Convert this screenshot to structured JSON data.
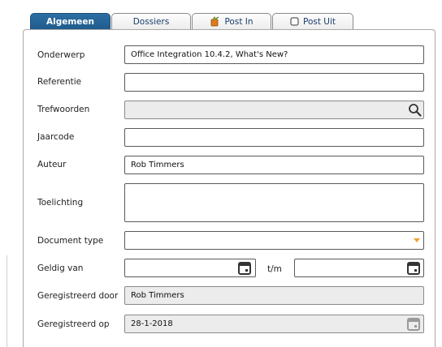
{
  "tabs": [
    {
      "label": "Algemeen",
      "active": true
    },
    {
      "label": "Dossiers",
      "active": false
    },
    {
      "label": "Post In",
      "active": false,
      "icon": "mail-in-icon"
    },
    {
      "label": "Post Uit",
      "active": false,
      "icon": "checkbox-icon"
    }
  ],
  "form": {
    "onderwerp": {
      "label": "Onderwerp",
      "value": "Office Integration 10.4.2, What's New?"
    },
    "referentie": {
      "label": "Referentie",
      "value": ""
    },
    "trefwoorden": {
      "label": "Trefwoorden",
      "value": "",
      "icon": "search-icon"
    },
    "jaarcode": {
      "label": "Jaarcode",
      "value": ""
    },
    "auteur": {
      "label": "Auteur",
      "value": "Rob Timmers"
    },
    "toelichting": {
      "label": "Toelichting",
      "value": ""
    },
    "document_type": {
      "label": "Document type",
      "value": "",
      "icon": "dropdown-arrow-icon"
    },
    "geldig_van": {
      "label": "Geldig van",
      "from": "",
      "to_label": "t/m",
      "to": "",
      "icon": "calendar-icon"
    },
    "geregistreerd_door": {
      "label": "Geregistreerd door",
      "value": "Rob Timmers"
    },
    "geregistreerd_op": {
      "label": "Geregistreerd op",
      "value": "28-1-2018",
      "icon": "calendar-icon"
    }
  },
  "colors": {
    "active_tab": "#1f5a8c",
    "tab_text": "#1a3d6e",
    "dropdown_arrow": "#f0a030",
    "readonly_bg": "#ececec"
  }
}
